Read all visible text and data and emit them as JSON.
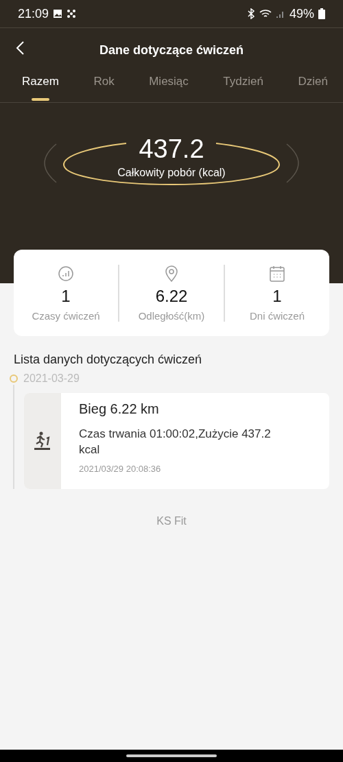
{
  "status_bar": {
    "time": "21:09",
    "battery": "49%"
  },
  "header": {
    "title": "Dane dotyczące ćwiczeń"
  },
  "tabs": [
    {
      "label": "Razem",
      "selected": true
    },
    {
      "label": "Rok",
      "selected": false
    },
    {
      "label": "Miesiąc",
      "selected": false
    },
    {
      "label": "Tydzień",
      "selected": false
    },
    {
      "label": "Dzień",
      "selected": false
    }
  ],
  "total": {
    "value": "437.2",
    "label": "Całkowity pobór (kcal)"
  },
  "stats": [
    {
      "kind": "chart",
      "value": "1",
      "label": "Czasy ćwiczeń"
    },
    {
      "kind": "location",
      "value": "6.22",
      "label": "Odległość(km)"
    },
    {
      "kind": "calendar",
      "value": "1",
      "label": "Dni ćwiczeń"
    }
  ],
  "list": {
    "title": "Lista danych dotyczących ćwiczeń",
    "groups": [
      {
        "date": "2021-03-29",
        "entries": [
          {
            "title": "Bieg 6.22 km",
            "detail": "Czas trwania 01:00:02,Zużycie 437.2 kcal",
            "timestamp": "2021/03/29 20:08:36"
          }
        ]
      }
    ]
  },
  "footer": "KS Fit"
}
